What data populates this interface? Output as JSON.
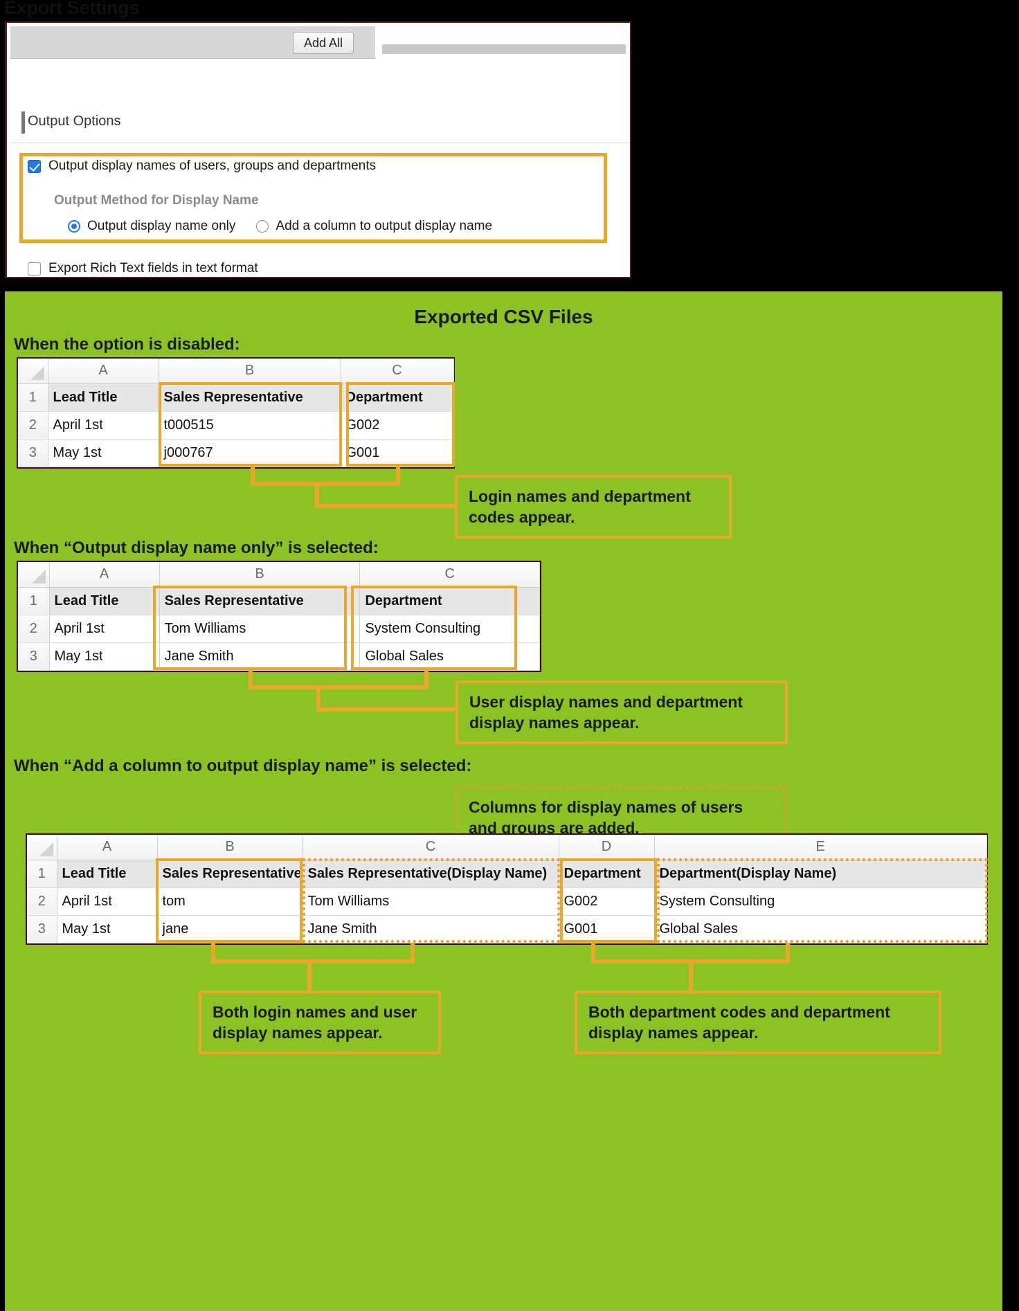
{
  "page_title": "Export Settings",
  "settings": {
    "add_all_button": "Add All",
    "section_header": "Output Options",
    "display_names_checkbox": {
      "label": "Output display names of users, groups and departments",
      "checked": true
    },
    "output_method_label": "Output Method for Display Name",
    "radio_display_only": "Output display name only",
    "radio_add_column": "Add a column to output display name",
    "selected_radio": "Output display name only",
    "rich_text_checkbox": {
      "label": "Export Rich Text fields in text format",
      "checked": false
    }
  },
  "results": {
    "title": "Exported CSV Files",
    "accent_color": "#EAA82A",
    "background_color": "#8CC224",
    "cases": [
      {
        "heading": "When the option is disabled:",
        "columns": [
          "A",
          "B",
          "C"
        ],
        "rows": [
          {
            "num": "1",
            "cells": [
              "Lead Title",
              "Sales Representative",
              "Department"
            ]
          },
          {
            "num": "2",
            "cells": [
              "April 1st",
              "t000515",
              "G002"
            ]
          },
          {
            "num": "3",
            "cells": [
              "May 1st",
              "j000767",
              "G001"
            ]
          }
        ],
        "callout": "Login names and department codes appear."
      },
      {
        "heading": "When “Output display name only” is selected:",
        "columns": [
          "A",
          "B",
          "C"
        ],
        "rows": [
          {
            "num": "1",
            "cells": [
              "Lead Title",
              "Sales Representative",
              "Department"
            ]
          },
          {
            "num": "2",
            "cells": [
              "April 1st",
              "Tom Williams",
              "System Consulting"
            ]
          },
          {
            "num": "3",
            "cells": [
              "May 1st",
              "Jane Smith",
              "Global Sales"
            ]
          }
        ],
        "callout": "User display names and department display names appear."
      },
      {
        "heading": "When “Add a column to output display name” is selected:",
        "columns": [
          "A",
          "B",
          "C",
          "D",
          "E"
        ],
        "rows": [
          {
            "num": "1",
            "cells": [
              "Lead Title",
              "Sales Representative",
              "Sales Representative(Display Name)",
              "Department",
              "Department(Display Name)"
            ]
          },
          {
            "num": "2",
            "cells": [
              "April 1st",
              "tom",
              "Tom Williams",
              "G002",
              "System Consulting"
            ]
          },
          {
            "num": "3",
            "cells": [
              "May 1st",
              "jane",
              "Jane Smith",
              "G001",
              "Global Sales"
            ]
          }
        ],
        "callout_top": "Columns for display names of users and groups are added.",
        "callout_left": "Both login names and user display names appear.",
        "callout_right": "Both department codes and department display names appear."
      }
    ]
  }
}
